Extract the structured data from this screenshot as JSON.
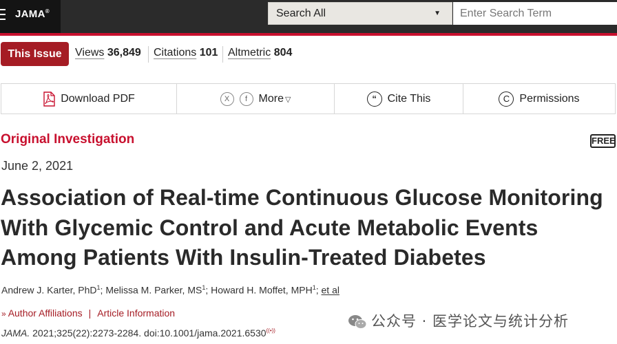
{
  "header": {
    "logo": "JAMA",
    "logo_mark": "®",
    "search_scope": "Search All",
    "search_placeholder": "Enter Search Term"
  },
  "metrics": {
    "issue_button": "This Issue",
    "views_label": "Views",
    "views_value": "36,849",
    "citations_label": "Citations",
    "citations_value": "101",
    "altmetric_label": "Altmetric",
    "altmetric_value": "804"
  },
  "toolbar": {
    "download_pdf": "Download PDF",
    "share_x": "X",
    "share_f": "f",
    "more": "More",
    "cite": "Cite This",
    "cite_glyph": "“",
    "permissions": "Permissions",
    "permissions_glyph": "C"
  },
  "article": {
    "type": "Original Investigation",
    "free_badge": "FREE",
    "date": "June 2, 2021",
    "title": "Association of Real-time Continuous Glucose Monitoring With Glycemic Control and Acute Metabolic Events Among Patients With Insulin-Treated Diabetes",
    "authors": [
      {
        "name": "Andrew J. Karter, PhD",
        "sup": "1"
      },
      {
        "name": "Melissa M. Parker, MS",
        "sup": "1"
      },
      {
        "name": "Howard H. Moffet, MPH",
        "sup": "1"
      }
    ],
    "et_al": "et al",
    "author_affiliations": "Author Affiliations",
    "article_information": "Article Information",
    "journal": "JAMA.",
    "citation": "2021;325(22):2273-2284. doi:10.1001/jama.2021.6530"
  },
  "watermark": "公众号 · 医学论文与统计分析",
  "colors": {
    "brand_red": "#c8102e",
    "issue_red": "#a51c24",
    "topbar": "#2b2b2b"
  }
}
